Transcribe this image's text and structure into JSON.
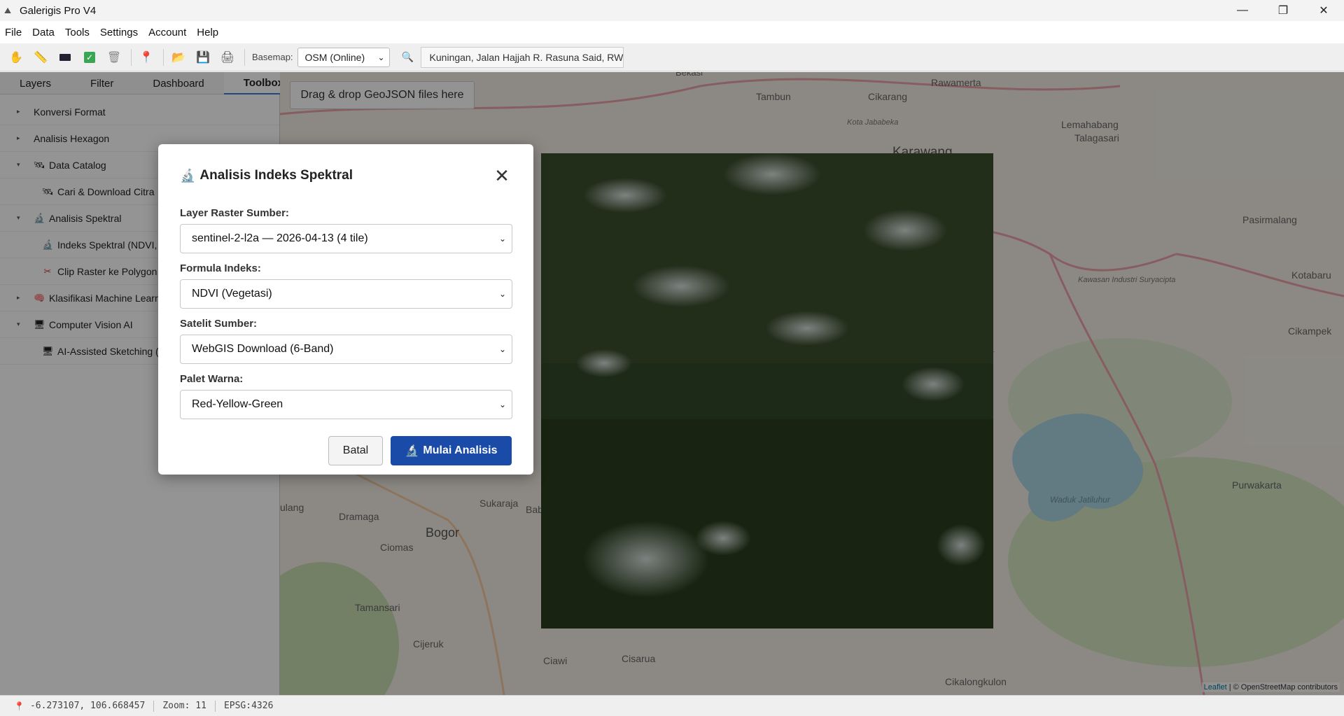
{
  "window": {
    "title": "Galerigis Pro V4",
    "controls": {
      "minimize": "—",
      "maximize": "❐",
      "close": "✕"
    }
  },
  "menu": {
    "items": [
      "File",
      "Data",
      "Tools",
      "Settings",
      "Account",
      "Help"
    ]
  },
  "toolbar": {
    "basemap_label": "Basemap:",
    "basemap_value": "OSM (Online)",
    "search_value": "Kuningan, Jalan Hajjah R. Rasuna Said, RW",
    "icons": [
      "hand-icon",
      "ruler-icon",
      "rectangle-icon",
      "checkmark-icon",
      "trash-icon",
      "pin-icon",
      "folder-icon",
      "save-icon",
      "print-icon"
    ]
  },
  "sidebar": {
    "tabs": [
      "Layers",
      "Filter",
      "Dashboard",
      "Toolbox"
    ],
    "active_tab": "Toolbox",
    "tree": [
      {
        "label": "Konversi Format",
        "arrow": "▸",
        "icon": "",
        "level": 0
      },
      {
        "label": "Analisis Hexagon",
        "arrow": "▸",
        "icon": "",
        "level": 0
      },
      {
        "label": "Data Catalog",
        "arrow": "▾",
        "icon": "🛰",
        "level": 0
      },
      {
        "label": "Cari & Download Citra",
        "arrow": "",
        "icon": "🛰",
        "level": 1
      },
      {
        "label": "Analisis Spektral",
        "arrow": "▾",
        "icon": "🔬",
        "level": 0
      },
      {
        "label": "Indeks Spektral (NDVI, I",
        "arrow": "",
        "icon": "🔬",
        "level": 1
      },
      {
        "label": "Clip Raster ke Polygon",
        "arrow": "",
        "icon": "✂",
        "level": 1
      },
      {
        "label": "Klasifikasi Machine Learn",
        "arrow": "▸",
        "icon": "🧠",
        "level": 0
      },
      {
        "label": "Computer Vision AI",
        "arrow": "▾",
        "icon": "🖥",
        "level": 0
      },
      {
        "label": "AI-Assisted Sketching (",
        "arrow": "",
        "icon": "🖥",
        "level": 1
      }
    ]
  },
  "map": {
    "dropzone_text": "Drag & drop GeoJSON files here",
    "attribution_leaflet": "Leaflet",
    "attribution_rest": " | © OpenStreetMap contributors",
    "places": [
      {
        "name": "Karawang"
      },
      {
        "name": "Rawamerta"
      },
      {
        "name": "Lemahabang"
      },
      {
        "name": "Talagasari"
      },
      {
        "name": "Tambun"
      },
      {
        "name": "Cikarang"
      },
      {
        "name": "Kota Jababeka"
      },
      {
        "name": "Pasirmalang"
      },
      {
        "name": "Kotabaru"
      },
      {
        "name": "Cikampek"
      },
      {
        "name": "Kawasan Industri Suryacipta"
      },
      {
        "name": "Purwakarta"
      },
      {
        "name": "Waduk Jatiluhur"
      },
      {
        "name": "Bogor"
      },
      {
        "name": "Dramaga"
      },
      {
        "name": "Ciomas"
      },
      {
        "name": "Sukaraja"
      },
      {
        "name": "Tamansari"
      },
      {
        "name": "Cijeruk"
      },
      {
        "name": "Ciawi"
      },
      {
        "name": "Cisarua"
      },
      {
        "name": "Cikalongkulon"
      },
      {
        "name": "ulang"
      },
      {
        "name": "Bab"
      },
      {
        "name": "Bekasi"
      }
    ]
  },
  "status": {
    "coords": "-6.273107, 106.668457",
    "zoom": "Zoom: 11",
    "epsg": "EPSG:4326"
  },
  "dialog": {
    "title": "Analisis Indeks Spektral",
    "title_icon": "microscope-icon",
    "fields": [
      {
        "label": "Layer Raster Sumber:",
        "value": "sentinel-2-l2a — 2026-04-13 (4 tile)"
      },
      {
        "label": "Formula Indeks:",
        "value": "NDVI (Vegetasi)"
      },
      {
        "label": "Satelit Sumber:",
        "value": "WebGIS Download (6-Band)"
      },
      {
        "label": "Palet Warna:",
        "value": "Red-Yellow-Green"
      }
    ],
    "cancel_label": "Batal",
    "submit_label": "Mulai Analisis"
  }
}
